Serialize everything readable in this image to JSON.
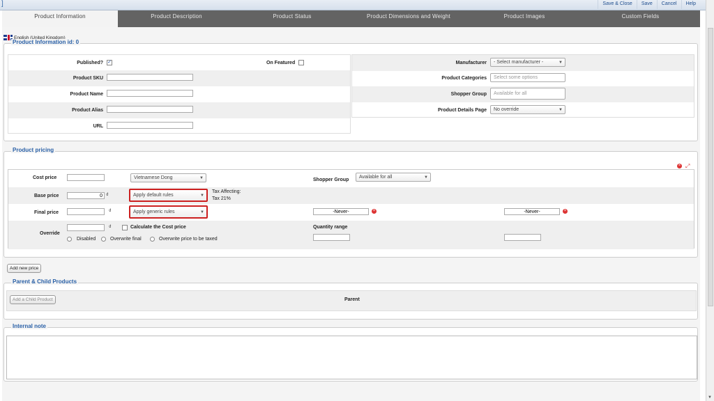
{
  "toolbar": {
    "save_close": "Save & Close",
    "save": "Save",
    "cancel": "Cancel",
    "help": "Help"
  },
  "tabs": [
    {
      "label": "Product Information"
    },
    {
      "label": "Product Description"
    },
    {
      "label": "Product Status"
    },
    {
      "label": "Product Dimensions and Weight"
    },
    {
      "label": "Product Images"
    },
    {
      "label": "Custom Fields"
    }
  ],
  "language": "English (United Kingdom)",
  "product_info": {
    "legend": "Product Information id: 0",
    "published_label": "Published?",
    "published_checked": true,
    "published_mark": "✓",
    "featured_label": "On Featured",
    "sku_label": "Product SKU",
    "name_label": "Product Name",
    "alias_label": "Product Alias",
    "url_label": "URL",
    "manufacturer_label": "Manufacturer",
    "manufacturer_value": "- Select manufacturer -",
    "categories_label": "Product Categories",
    "categories_placeholder": "Select some options",
    "shopper_group_label": "Shopper Group",
    "shopper_group_placeholder": "Available for all",
    "details_page_label": "Product Details Page",
    "details_page_value": "No override"
  },
  "pricing": {
    "legend": "Product pricing",
    "cost_label": "Cost price",
    "currency": "Vietnamese Dong",
    "base_label": "Base price",
    "base_value": "0",
    "currency_symbol": "₫",
    "tax_rule": "Apply default rules",
    "tax_affecting": "Tax Affecting:",
    "tax_rate": "Tax 21%",
    "final_label": "Final price",
    "discount_rule": "Apply generic rules",
    "override_label": "Override",
    "calc_cost": "Calculate the Cost price",
    "opt_disabled": "Disabled",
    "opt_overwrite_final": "Overwrite final",
    "opt_overwrite_taxed": "Overwrite price to be taxed",
    "shopper_group_label": "Shopper Group",
    "shopper_group_value": "Available for all",
    "never_from": "-Never-",
    "never_to": "-Never-",
    "quantity_range_label": "Quantity range",
    "add_price": "Add new price"
  },
  "parent_child": {
    "legend": "Parent & Child Products",
    "add_child": "Add a Child Product",
    "parent_label": "Parent"
  },
  "internal_note": {
    "legend": "Internal note"
  },
  "icons": {
    "delete": "×",
    "expand": "⤢",
    "caret": "▼",
    "calendar_clear": "×"
  }
}
